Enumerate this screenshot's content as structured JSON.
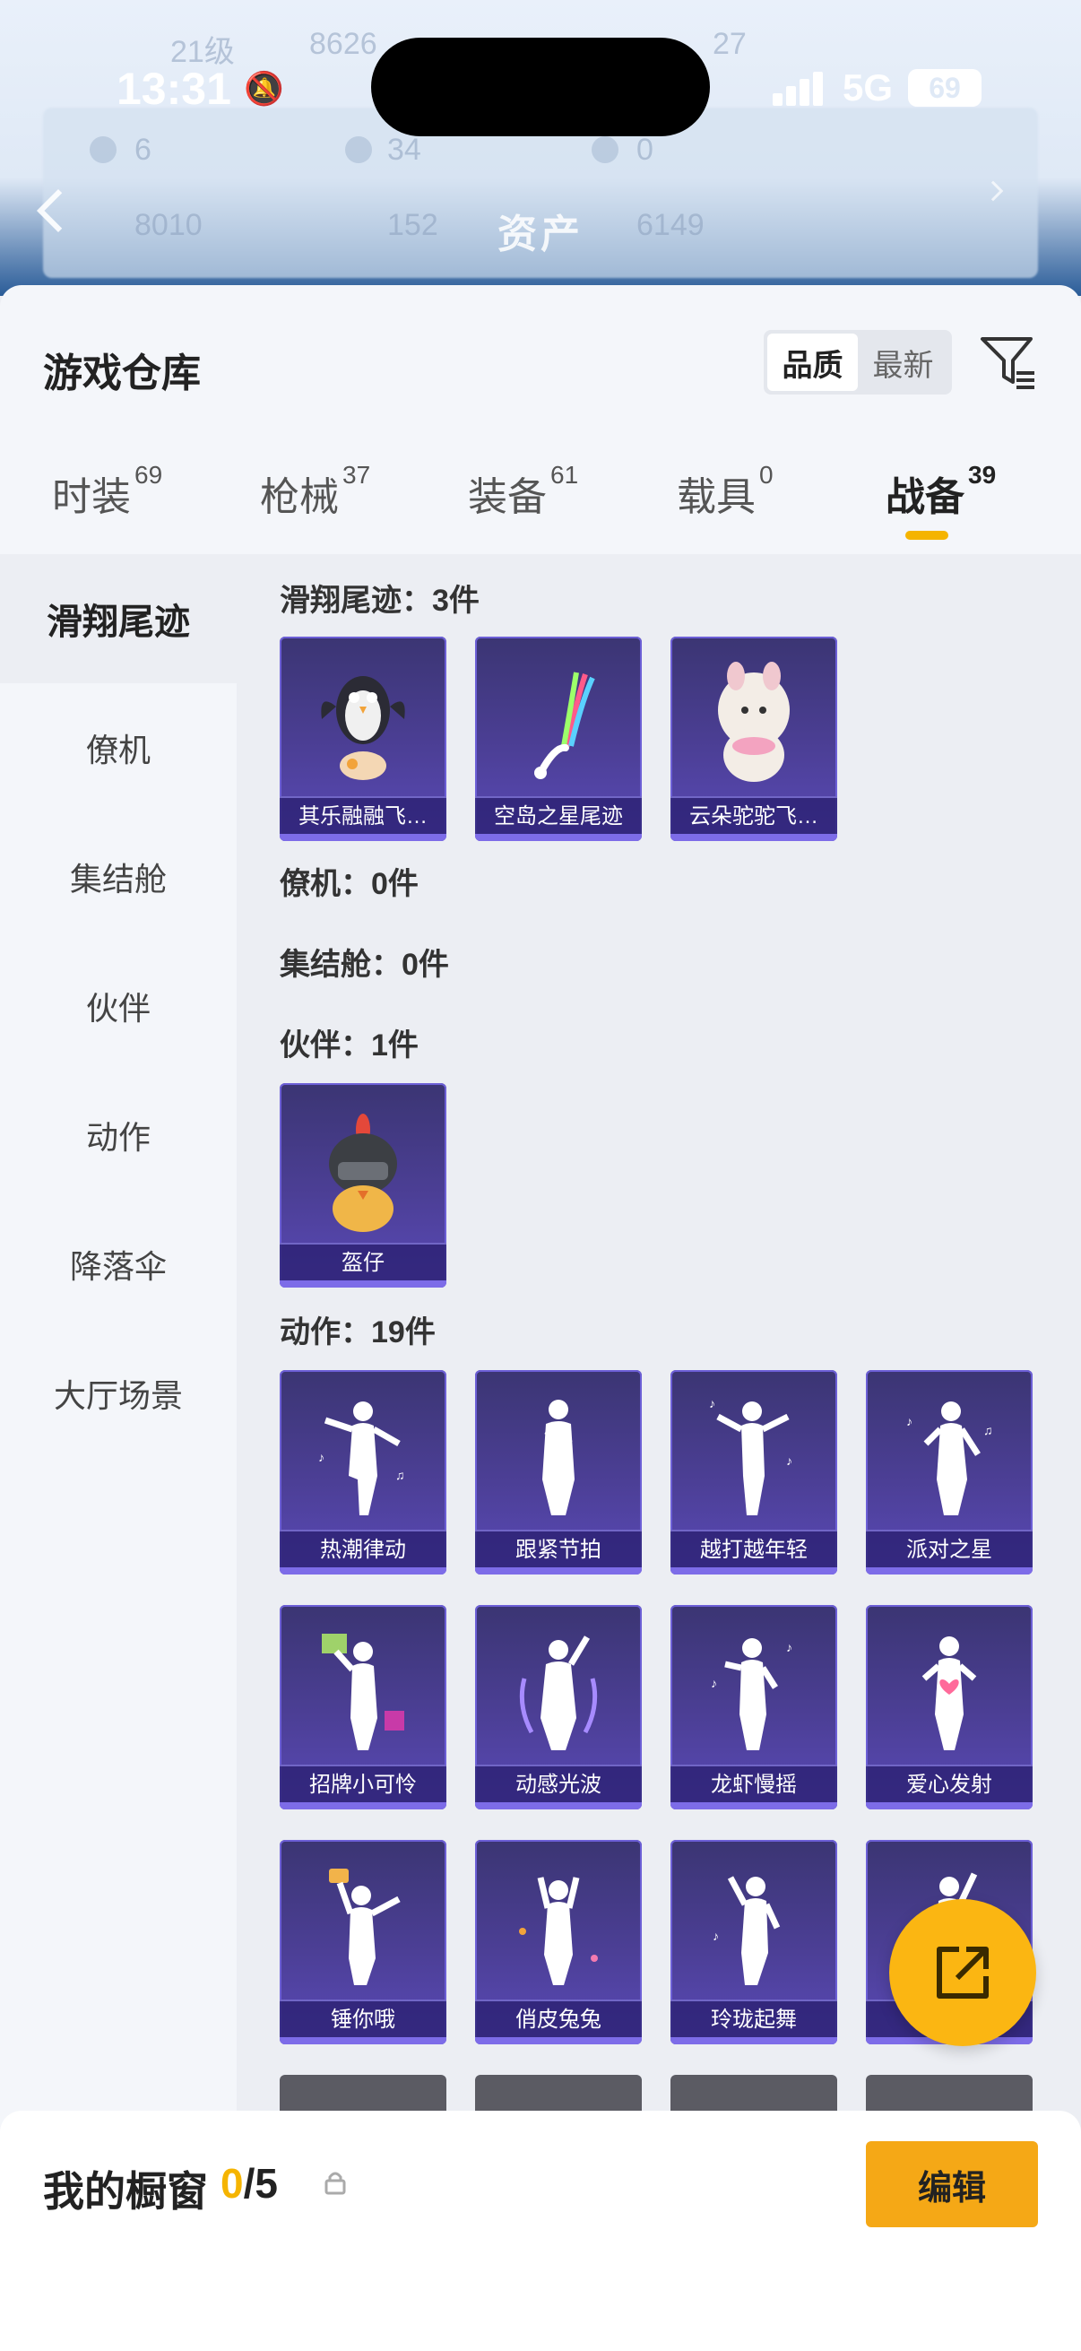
{
  "status": {
    "time": "13:31",
    "network": "5G",
    "battery": "69"
  },
  "background": {
    "title": "资产",
    "faded": [
      "21级",
      "8626",
      "6",
      "34",
      "0",
      "8010",
      "152",
      "6149",
      "27"
    ]
  },
  "header": {
    "title": "游戏仓库",
    "sort_options": [
      "品质",
      "最新"
    ],
    "sort_active": "品质"
  },
  "tabs": [
    {
      "label": "时装",
      "count": "69"
    },
    {
      "label": "枪械",
      "count": "37"
    },
    {
      "label": "装备",
      "count": "61"
    },
    {
      "label": "载具",
      "count": "0"
    },
    {
      "label": "战备",
      "count": "39"
    }
  ],
  "active_tab": "战备",
  "sidebar": {
    "items": [
      {
        "label": "滑翔尾迹"
      },
      {
        "label": "僚机"
      },
      {
        "label": "集结舱"
      },
      {
        "label": "伙伴"
      },
      {
        "label": "动作"
      },
      {
        "label": "降落伞"
      },
      {
        "label": "大厅场景"
      }
    ]
  },
  "sections": {
    "glide": {
      "label": "滑翔尾迹：3件",
      "items": [
        "其乐融融飞…",
        "空岛之星尾迹",
        "云朵驼驼飞…"
      ]
    },
    "wingman": {
      "label": "僚机：0件"
    },
    "pod": {
      "label": "集结舱：0件"
    },
    "partner": {
      "label": "伙伴：1件",
      "items": [
        "盔仔"
      ]
    },
    "emote": {
      "label": "动作：19件",
      "items": [
        "热潮律动",
        "跟紧节拍",
        "越打越年轻",
        "派对之星",
        "招牌小可怜",
        "动感光波",
        "龙虾慢摇",
        "爱心发射",
        "锤你哦",
        "俏皮兔兔",
        "玲珑起舞",
        ""
      ]
    }
  },
  "bottom": {
    "window_label": "我的橱窗",
    "window_used": "0",
    "window_total": "/5",
    "edit_label": "编辑"
  },
  "colors": {
    "accent": "#f5b400",
    "card_bg": "#4c3f96",
    "fab": "#fbb612"
  }
}
